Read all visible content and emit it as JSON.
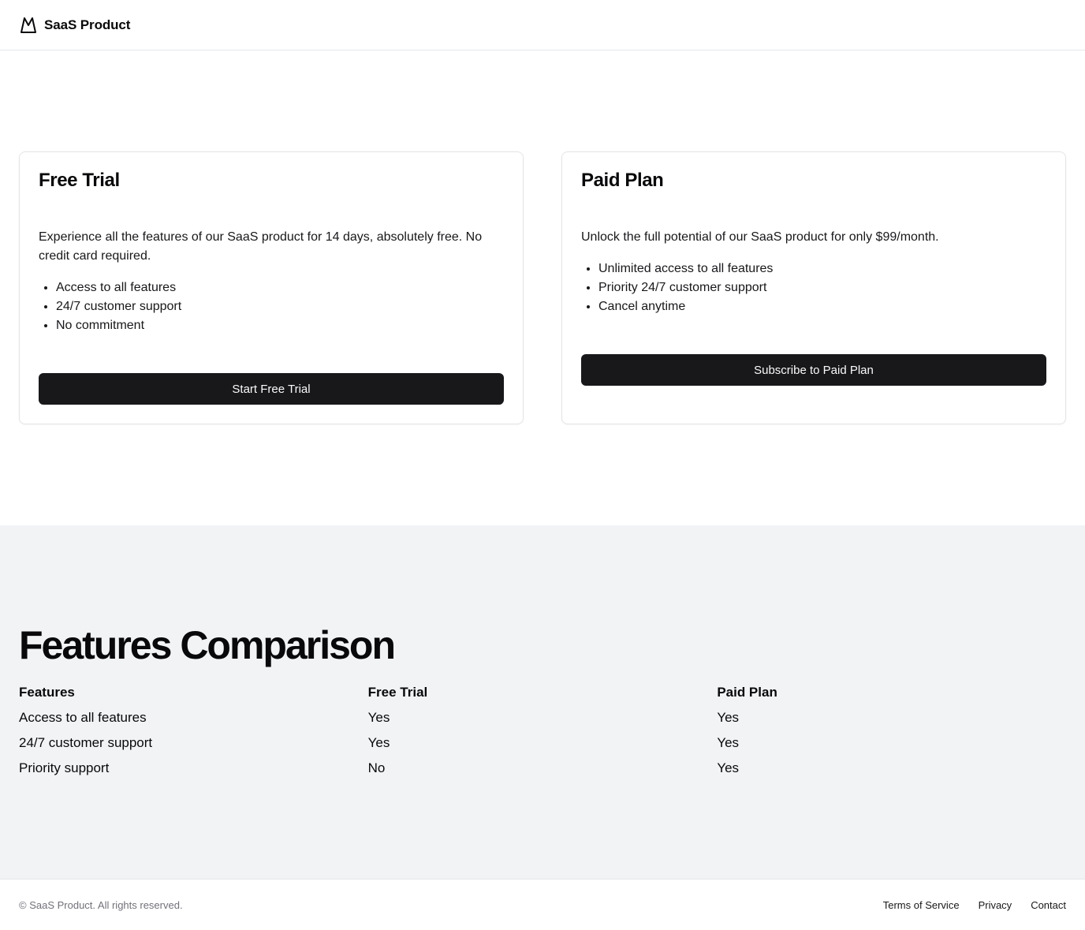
{
  "header": {
    "logo_icon": "mountain-icon",
    "brand": "SaaS Product"
  },
  "plans": [
    {
      "title": "Free Trial",
      "description": "Experience all the features of our SaaS product for 14 days, absolutely free. No credit card required.",
      "features": [
        "Access to all features",
        "24/7 customer support",
        "No commitment"
      ],
      "button_label": "Start Free Trial"
    },
    {
      "title": "Paid Plan",
      "description": "Unlock the full potential of our SaaS product for only $99/month.",
      "features": [
        "Unlimited access to all features",
        "Priority 24/7 customer support",
        "Cancel anytime"
      ],
      "button_label": "Subscribe to Paid Plan"
    }
  ],
  "comparison": {
    "title": "Features Comparison",
    "headers": [
      "Features",
      "Free Trial",
      "Paid Plan"
    ],
    "rows": [
      [
        "Access to all features",
        "Yes",
        "Yes"
      ],
      [
        "24/7 customer support",
        "Yes",
        "Yes"
      ],
      [
        "Priority support",
        "No",
        "Yes"
      ]
    ]
  },
  "footer": {
    "copyright": "© SaaS Product. All rights reserved.",
    "links": [
      "Terms of Service",
      "Privacy",
      "Contact"
    ]
  },
  "colors": {
    "primary_button": "#18181b",
    "section_background": "#f1f3f5",
    "border": "#e4e4e7"
  }
}
